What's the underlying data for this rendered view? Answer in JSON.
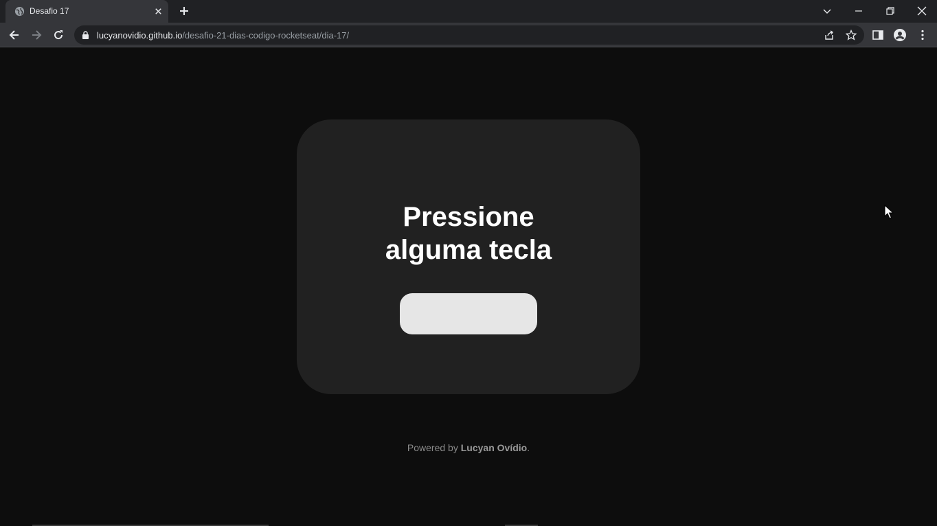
{
  "browser": {
    "tab_title": "Desafio 17",
    "url_host": "lucyanovidio.github.io",
    "url_path": "/desafio-21-dias-codigo-rocketseat/dia-17/"
  },
  "page": {
    "heading_line1": "Pressione",
    "heading_line2": "alguma tecla",
    "key_display": "",
    "footer_prefix": "Powered by ",
    "footer_author": "Lucyan Ovídio",
    "footer_suffix": "."
  },
  "colors": {
    "page_bg": "#0d0d0d",
    "card_bg": "#212121",
    "key_box_bg": "#e6e6e6",
    "heading": "#ffffff"
  }
}
